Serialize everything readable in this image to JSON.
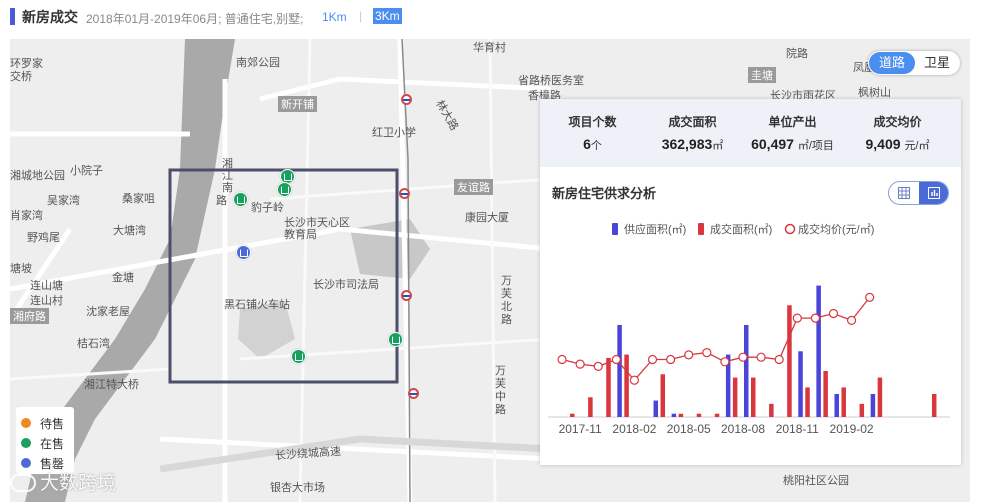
{
  "header": {
    "title": "新房成交",
    "range": "2018年01月-2019年06月; 普通住宅,别墅;",
    "radius_options": [
      "1Km",
      "3Km"
    ],
    "selected_radius": "3Km",
    "separator": "|"
  },
  "map": {
    "layer_toggle": [
      "道路",
      "卫星"
    ],
    "selected_layer": "道路",
    "labels": [
      "环罗家",
      "交桥",
      "南郊公园",
      "华育村",
      "院路",
      "凤凰",
      "省路桥医务室",
      "圭塘",
      "枫树山",
      "新开铺",
      "长沙市雨花区",
      "香樟路",
      "红卫小学",
      "林大路",
      "友谊路",
      "湘",
      "江",
      "南",
      "路",
      "豹子岭",
      "湘城地公园",
      "小院子",
      "吴家湾",
      "肖家湾",
      "桑家咀",
      "长沙市天心区",
      "教育局",
      "康园大厦",
      "大塘湾",
      "野鸡尾",
      "塘坡",
      "金塘",
      "连山塘",
      "连山村",
      "长沙市司法局",
      "万芙北路",
      "黑石铺火车站",
      "沈家老屋",
      "湘府路",
      "桔石湾",
      "湘江特大桥",
      "万芙中路",
      "长沙绕城高速",
      "银杏大市场",
      "桃阳社区公园"
    ],
    "legend": [
      {
        "label": "待售",
        "color": "#f08a24"
      },
      {
        "label": "在售",
        "color": "#17a05e"
      },
      {
        "label": "售罄",
        "color": "#4a6ad8"
      }
    ],
    "watermark": "大数跨境"
  },
  "panel": {
    "stats": [
      {
        "label": "项目个数",
        "value": "6",
        "unit": "个"
      },
      {
        "label": "成交面积",
        "value": "362,983",
        "unit": "㎡"
      },
      {
        "label": "单位产出",
        "value": "60,497",
        "unit": "㎡/项目"
      },
      {
        "label": "成交均价",
        "value": "9,409",
        "unit": "元/㎡"
      }
    ],
    "title": "新房住宅供求分析",
    "view_icons": [
      "table-icon",
      "bar-chart-icon"
    ]
  },
  "chart_data": {
    "type": "bar",
    "legend": [
      "供应面积(㎡)",
      "成交面积(㎡)",
      "成交均价(元/㎡)"
    ],
    "x_tick_labels": [
      "2017-11",
      "2018-02",
      "2018-05",
      "2018-08",
      "2018-11",
      "2019-02"
    ],
    "categories": [
      "2017-10",
      "2017-11",
      "2017-12",
      "2018-01",
      "2018-02",
      "2018-03",
      "2018-04",
      "2018-05",
      "2018-06",
      "2018-07",
      "2018-08",
      "2018-09",
      "2018-10",
      "2018-11",
      "2018-12",
      "2019-01",
      "2019-02",
      "2019-03",
      "2019-04",
      "2019-05",
      "2019-06"
    ],
    "series": [
      {
        "name": "供应面积(㎡)",
        "kind": "bar",
        "color": "#4a44d8",
        "values": [
          0,
          0,
          0,
          28,
          0,
          5,
          1,
          0,
          0,
          19,
          28,
          0,
          0,
          20,
          40,
          7,
          0,
          7,
          0,
          0,
          0
        ]
      },
      {
        "name": "成交面积(㎡)",
        "kind": "bar",
        "color": "#d9363e",
        "values": [
          1,
          6,
          18,
          19,
          0,
          13,
          1,
          1,
          1,
          12,
          12,
          4,
          34,
          9,
          14,
          9,
          4,
          12,
          0,
          0,
          7
        ]
      },
      {
        "name": "成交均价(元/㎡)",
        "kind": "line",
        "color": "#d9363e",
        "values": [
          6500,
          6300,
          6200,
          6500,
          5600,
          6500,
          6500,
          6700,
          6800,
          6400,
          6600,
          6600,
          6500,
          8300,
          8300,
          8500,
          8200,
          9200
        ]
      }
    ],
    "price_categories": [
      "2017-10",
      "2017-11",
      "2017-12",
      "2018-01",
      "2018-02",
      "2018-03",
      "2018-04",
      "2018-05",
      "2018-06",
      "2018-07",
      "2018-08",
      "2018-09",
      "2018-10",
      "2018-11",
      "2018-12",
      "2019-01",
      "2019-02",
      "2019-03"
    ],
    "bar_ylim": [
      0,
      42
    ],
    "price_ylim": [
      4000,
      10000
    ]
  }
}
